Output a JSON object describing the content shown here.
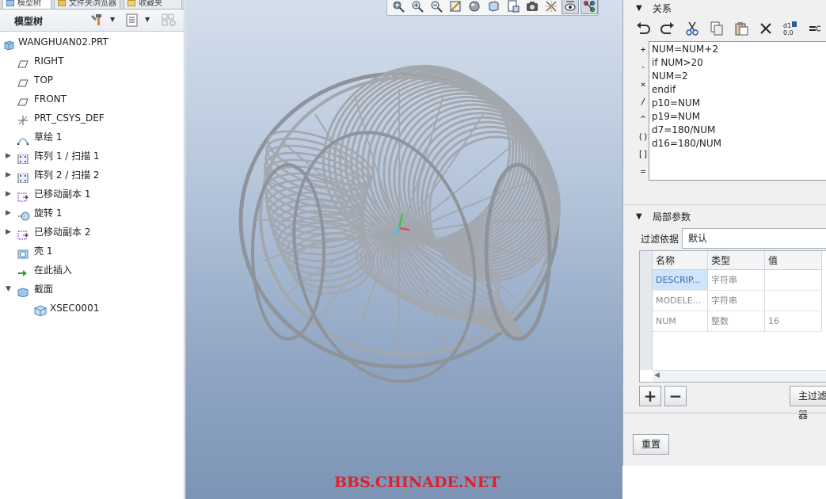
{
  "colors": {
    "viewport_top": "#d4dfec",
    "viewport_bottom": "#7d94b6",
    "watermark": "#e0202a",
    "selected_cell": "#cfe5fb",
    "wire": "#a3a7ae"
  },
  "left_panel": {
    "tabs": [
      {
        "label": "模型树",
        "icon": "model-tree-icon"
      },
      {
        "label": "文件夹浏览器",
        "icon": "folder-icon"
      },
      {
        "label": "收藏夹",
        "icon": "favorites-icon"
      }
    ],
    "toolbar_title": "模型树",
    "toolbar_icons": [
      "settings-tools-icon",
      "show-columns-icon",
      "filter-tree-icon"
    ],
    "tree": [
      {
        "label": "WANGHUAN02.PRT",
        "icon": "part-icon",
        "expand": "",
        "level": 0
      },
      {
        "label": "RIGHT",
        "icon": "datum-plane-icon",
        "expand": "",
        "level": 1
      },
      {
        "label": "TOP",
        "icon": "datum-plane-icon",
        "expand": "",
        "level": 1
      },
      {
        "label": "FRONT",
        "icon": "datum-plane-icon",
        "expand": "",
        "level": 1
      },
      {
        "label": "PRT_CSYS_DEF",
        "icon": "csys-icon",
        "expand": "",
        "level": 1
      },
      {
        "label": "草绘 1",
        "icon": "sketch-icon",
        "expand": "",
        "level": 1
      },
      {
        "label": "阵列 1 / 扫描 1",
        "icon": "pattern-icon",
        "expand": "▶",
        "level": 1
      },
      {
        "label": "阵列 2 / 扫描 2",
        "icon": "pattern-icon",
        "expand": "▶",
        "level": 1
      },
      {
        "label": "已移动副本 1",
        "icon": "moved-copy-icon",
        "expand": "▶",
        "level": 1
      },
      {
        "label": "旋转 1",
        "icon": "revolve-icon",
        "expand": "▶",
        "level": 1
      },
      {
        "label": "已移动副本 2",
        "icon": "moved-copy-icon",
        "expand": "▶",
        "level": 1
      },
      {
        "label": "壳 1",
        "icon": "shell-icon",
        "expand": "",
        "level": 1
      },
      {
        "label": "在此插入",
        "icon": "insert-here-icon",
        "expand": "",
        "level": 1
      },
      {
        "label": "截面",
        "icon": "section-icon",
        "expand": "▼",
        "level": 1
      },
      {
        "label": "XSEC0001",
        "icon": "xsec-icon",
        "expand": "",
        "level": 2
      }
    ]
  },
  "view_toolbar": {
    "buttons": [
      {
        "icon": "refit-icon",
        "active": false
      },
      {
        "icon": "zoom-in-icon",
        "active": false
      },
      {
        "icon": "zoom-out-icon",
        "active": false
      },
      {
        "icon": "repaint-icon",
        "active": false
      },
      {
        "icon": "display-style-icon",
        "active": false
      },
      {
        "icon": "saved-orientations-icon",
        "active": false
      },
      {
        "icon": "view-manager-icon",
        "active": false
      },
      {
        "icon": "perspective-icon",
        "active": false
      },
      {
        "icon": "datum-display-icon",
        "active": false
      },
      {
        "icon": "annotation-display-icon",
        "active": true
      },
      {
        "icon": "spin-center-icon",
        "active": true
      }
    ]
  },
  "viewport": {
    "watermark": "BBS.CHINADE.NET"
  },
  "relations": {
    "title": "关系",
    "toolbar_icons": [
      "undo-icon",
      "redo-icon",
      "cut-icon",
      "copy-icon",
      "paste-icon",
      "delete-icon",
      "evaluate-icon",
      "insert-equals-icon"
    ],
    "operators": [
      "+",
      "-",
      "×",
      "/",
      "^",
      "()",
      "[]",
      "="
    ],
    "lines": [
      "NUM=NUM+2",
      "if NUM>20",
      "NUM=2",
      "endif",
      "p10=NUM",
      "p19=NUM",
      "d7=180/NUM",
      "d16=180/NUM"
    ]
  },
  "local_params": {
    "title": "局部参数",
    "filter_label": "过滤依据",
    "filter_value": "默认",
    "columns": [
      "名称",
      "类型",
      "值"
    ],
    "rows": [
      {
        "name": "DESCRIP...",
        "type": "字符串",
        "value": "",
        "selected": true
      },
      {
        "name": "MODELE...",
        "type": "字符串",
        "value": "",
        "selected": false
      },
      {
        "name": "NUM",
        "type": "整数",
        "value": "16",
        "selected": false
      }
    ],
    "add_label": "+",
    "remove_label": "−",
    "main_filter_label": "主过滤器",
    "reset_label": "重置"
  }
}
